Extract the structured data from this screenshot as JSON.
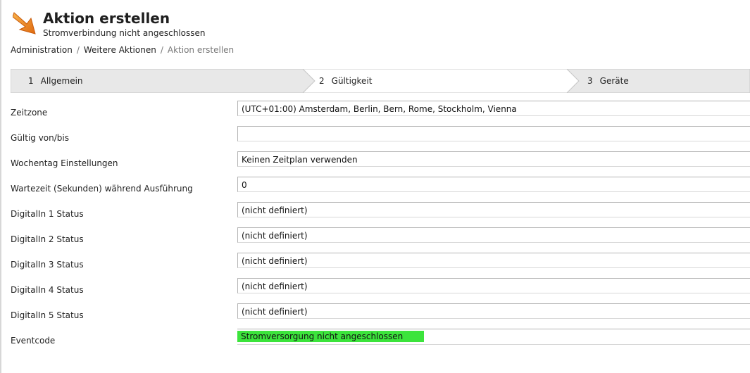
{
  "header": {
    "title": "Aktion erstellen",
    "subtitle": "Stromverbindung nicht angeschlossen"
  },
  "breadcrumb": {
    "items": [
      "Administration",
      "Weitere Aktionen",
      "Aktion erstellen"
    ],
    "separator": "/"
  },
  "wizard": {
    "steps": [
      {
        "number": "1",
        "label": "Allgemein",
        "active": false
      },
      {
        "number": "2",
        "label": "Gültigkeit",
        "active": true
      },
      {
        "number": "3",
        "label": "Geräte",
        "active": false
      }
    ]
  },
  "form": {
    "fields": [
      {
        "label": "Zeitzone",
        "value": "(UTC+01:00) Amsterdam, Berlin, Bern, Rome, Stockholm, Vienna"
      },
      {
        "label": "Gültig von/bis",
        "value": ""
      },
      {
        "label": "Wochentag Einstellungen",
        "value": "Keinen Zeitplan verwenden"
      },
      {
        "label": "Wartezeit (Sekunden) während Ausführung",
        "value": "0"
      },
      {
        "label": "DigitalIn 1 Status",
        "value": "(nicht definiert)"
      },
      {
        "label": "DigitalIn 2 Status",
        "value": "(nicht definiert)"
      },
      {
        "label": "DigitalIn 3 Status",
        "value": "(nicht definiert)"
      },
      {
        "label": "DigitalIn 4 Status",
        "value": "(nicht definiert)"
      },
      {
        "label": "DigitalIn 5 Status",
        "value": "(nicht definiert)"
      },
      {
        "label": "Eventcode",
        "value": "Stromversorgung nicht angeschlossen"
      }
    ]
  },
  "colors": {
    "accent_orange": "#f08a1c",
    "event_highlight": "#3ce43c",
    "wizard_inactive": "#e8e8e8",
    "wizard_active": "#ffffff"
  },
  "icons": {
    "logo": "orange-arrow-icon"
  }
}
